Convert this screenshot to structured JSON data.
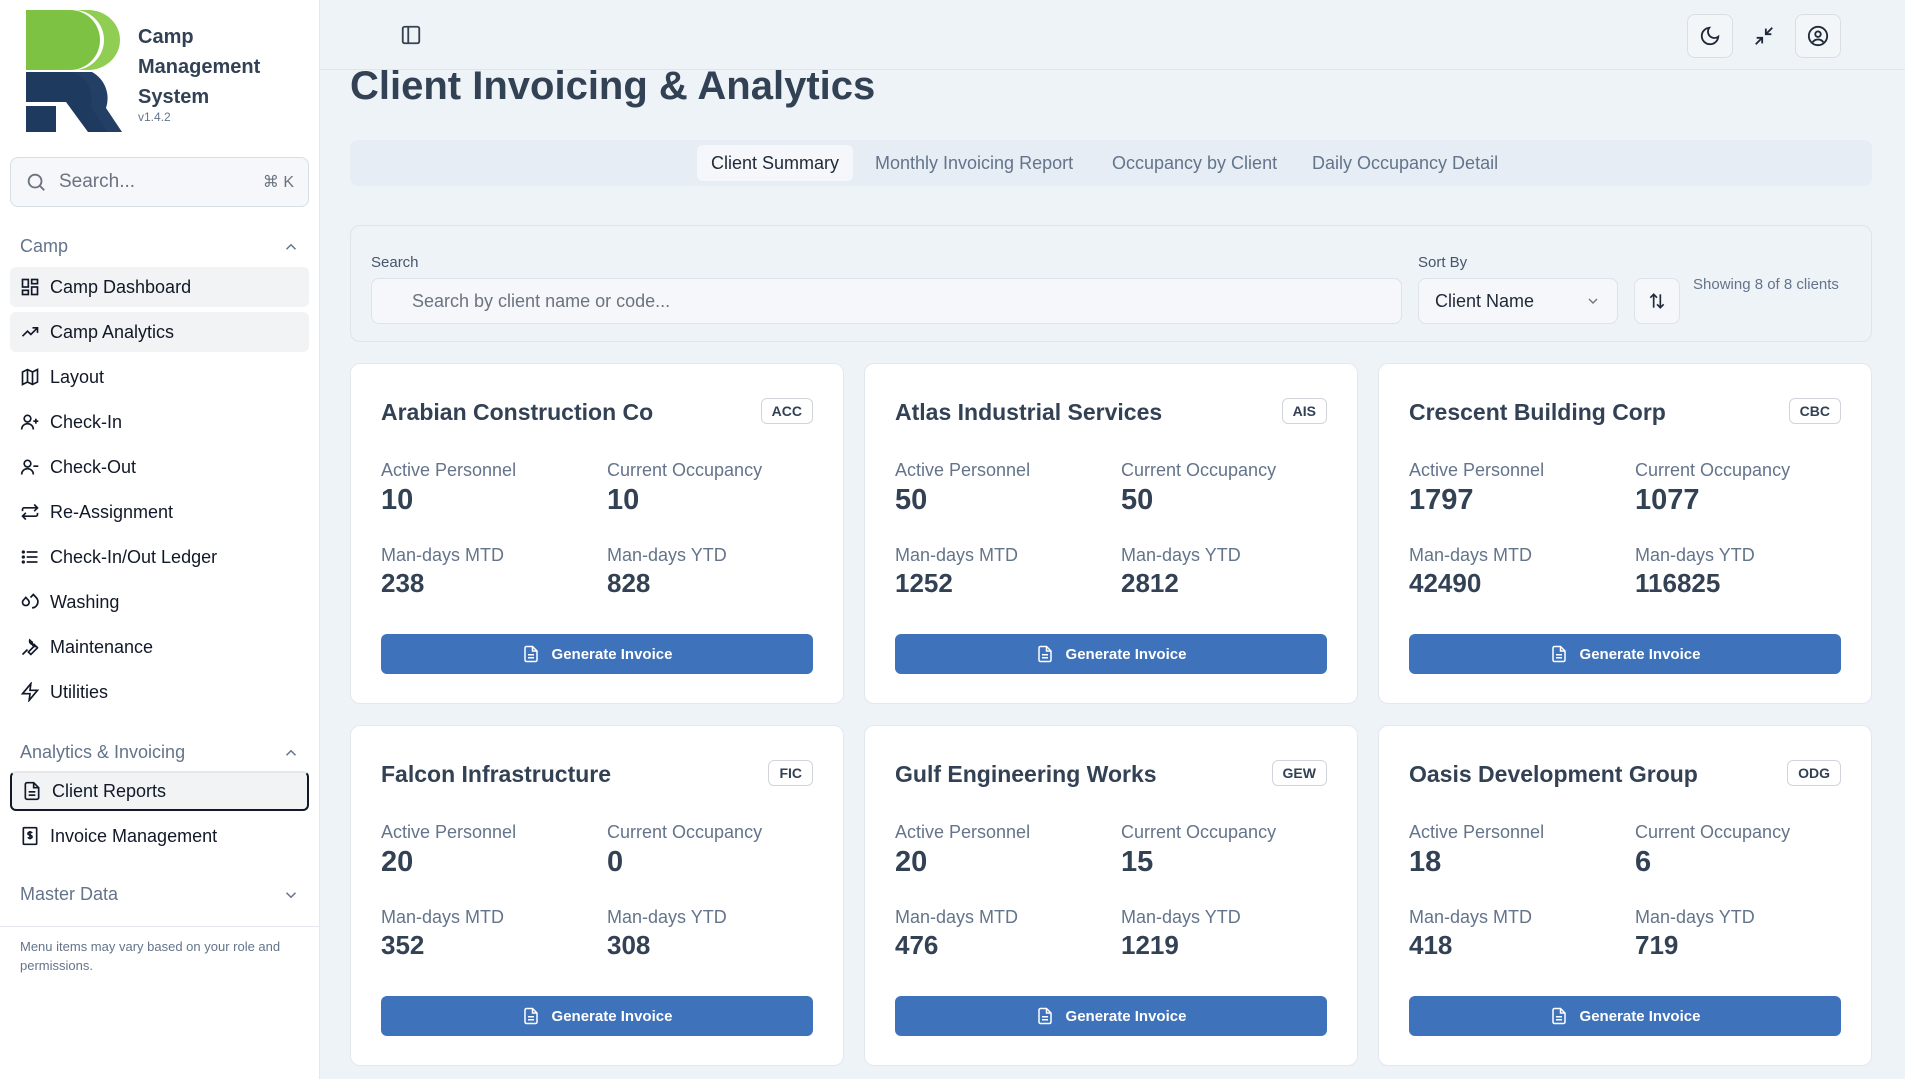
{
  "app": {
    "name": "Camp Management System",
    "version": "v1.4.2"
  },
  "sidebar": {
    "search_placeholder": "Search...",
    "search_shortcut": "⌘ K",
    "sections": [
      {
        "label": "Camp",
        "expanded": true,
        "items": [
          {
            "label": "Camp Dashboard",
            "icon": "dashboard-grid-icon"
          },
          {
            "label": "Camp Analytics",
            "icon": "trending-up-icon"
          },
          {
            "label": "Layout",
            "icon": "map-icon"
          },
          {
            "label": "Check-In",
            "icon": "user-plus-icon"
          },
          {
            "label": "Check-Out",
            "icon": "user-minus-icon"
          },
          {
            "label": "Re-Assignment",
            "icon": "swap-arrows-icon"
          },
          {
            "label": "Check-In/Out Ledger",
            "icon": "list-icon"
          },
          {
            "label": "Washing",
            "icon": "droplets-icon"
          },
          {
            "label": "Maintenance",
            "icon": "wrench-icon"
          },
          {
            "label": "Utilities",
            "icon": "zap-icon"
          }
        ]
      },
      {
        "label": "Analytics & Invoicing",
        "expanded": true,
        "items": [
          {
            "label": "Client Reports",
            "icon": "file-text-icon",
            "active": true
          },
          {
            "label": "Invoice Management",
            "icon": "receipt-icon"
          }
        ]
      },
      {
        "label": "Master Data",
        "expanded": false,
        "items": []
      }
    ],
    "note": "Menu items may vary based on your role and permissions."
  },
  "topbar": {
    "icons": [
      "panel-toggle-icon",
      "moon-icon",
      "minimize-icon",
      "user-circle-icon"
    ]
  },
  "page": {
    "title": "Client Invoicing & Analytics",
    "tabs": [
      {
        "label": "Client Summary",
        "active": true
      },
      {
        "label": "Monthly Invoicing Report"
      },
      {
        "label": "Occupancy by Client"
      },
      {
        "label": "Daily Occupancy Detail"
      }
    ],
    "filters": {
      "search_label": "Search",
      "search_placeholder": "Search by client name or code...",
      "sort_label": "Sort By",
      "sort_value": "Client Name",
      "count_text": "Showing 8 of 8 clients"
    },
    "stat_labels": {
      "active": "Active Personnel",
      "occupancy": "Current Occupancy",
      "mtd": "Man-days MTD",
      "ytd": "Man-days YTD"
    },
    "button_label": "Generate Invoice",
    "clients": [
      {
        "name": "Arabian Construction Co",
        "code": "ACC",
        "active": "10",
        "occupancy": "10",
        "mtd": "238",
        "ytd": "828"
      },
      {
        "name": "Atlas Industrial Services",
        "code": "AIS",
        "active": "50",
        "occupancy": "50",
        "mtd": "1252",
        "ytd": "2812"
      },
      {
        "name": "Crescent Building Corp",
        "code": "CBC",
        "active": "1797",
        "occupancy": "1077",
        "mtd": "42490",
        "ytd": "116825"
      },
      {
        "name": "Falcon Infrastructure",
        "code": "FIC",
        "active": "20",
        "occupancy": "0",
        "mtd": "352",
        "ytd": "308"
      },
      {
        "name": "Gulf Engineering Works",
        "code": "GEW",
        "active": "20",
        "occupancy": "15",
        "mtd": "476",
        "ytd": "1219"
      },
      {
        "name": "Oasis Development Group",
        "code": "ODG",
        "active": "18",
        "occupancy": "6",
        "mtd": "418",
        "ytd": "719"
      }
    ]
  },
  "colors": {
    "primary_button": "#3e72bb",
    "logo_green": "#7dc242",
    "logo_navy": "#1e3a5f"
  }
}
